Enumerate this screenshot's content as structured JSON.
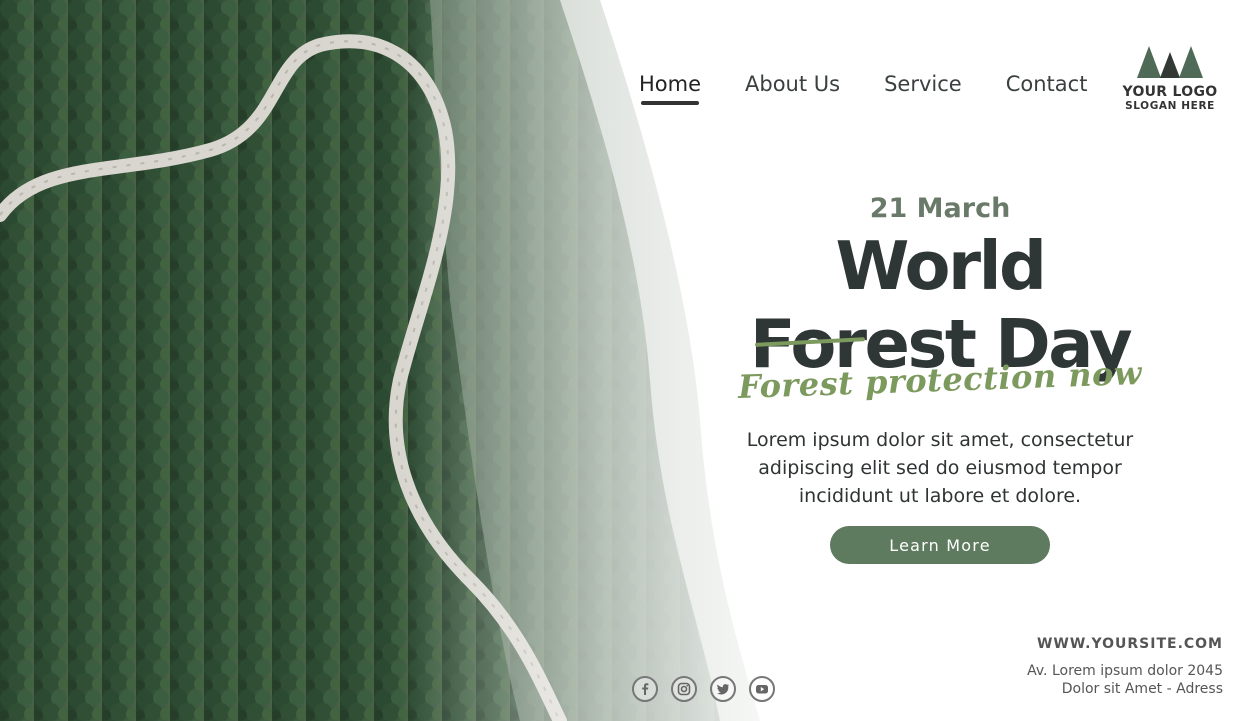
{
  "nav": {
    "items": [
      {
        "label": "Home",
        "active": true
      },
      {
        "label": "About Us",
        "active": false
      },
      {
        "label": "Service",
        "active": false
      },
      {
        "label": "Contact",
        "active": false
      }
    ]
  },
  "logo": {
    "icon": "pine-trees-icon",
    "text": "YOUR LOGO",
    "slogan": "SLOGAN HERE"
  },
  "hero": {
    "date": "21 March",
    "title_line1": "World",
    "title_line2": "Forest Day",
    "tagline": "Forest protection now",
    "description": "Lorem ipsum dolor sit amet, consectetur adipiscing elit sed do eiusmod tempor incididunt ut labore et dolore.",
    "cta_label": "Learn More"
  },
  "social": {
    "icons": [
      "facebook-icon",
      "instagram-icon",
      "twitter-icon",
      "youtube-icon"
    ]
  },
  "footer": {
    "website": "WWW.YOURSITE.COM",
    "address_line1": "Av. Lorem ipsum dolor 2045",
    "address_line2": "Dolor sit Amet - Adress"
  },
  "colors": {
    "accent": "#5f7b5f",
    "title": "#2f3636",
    "tagline": "#7d9a5e",
    "forest": "#2f4a33"
  }
}
